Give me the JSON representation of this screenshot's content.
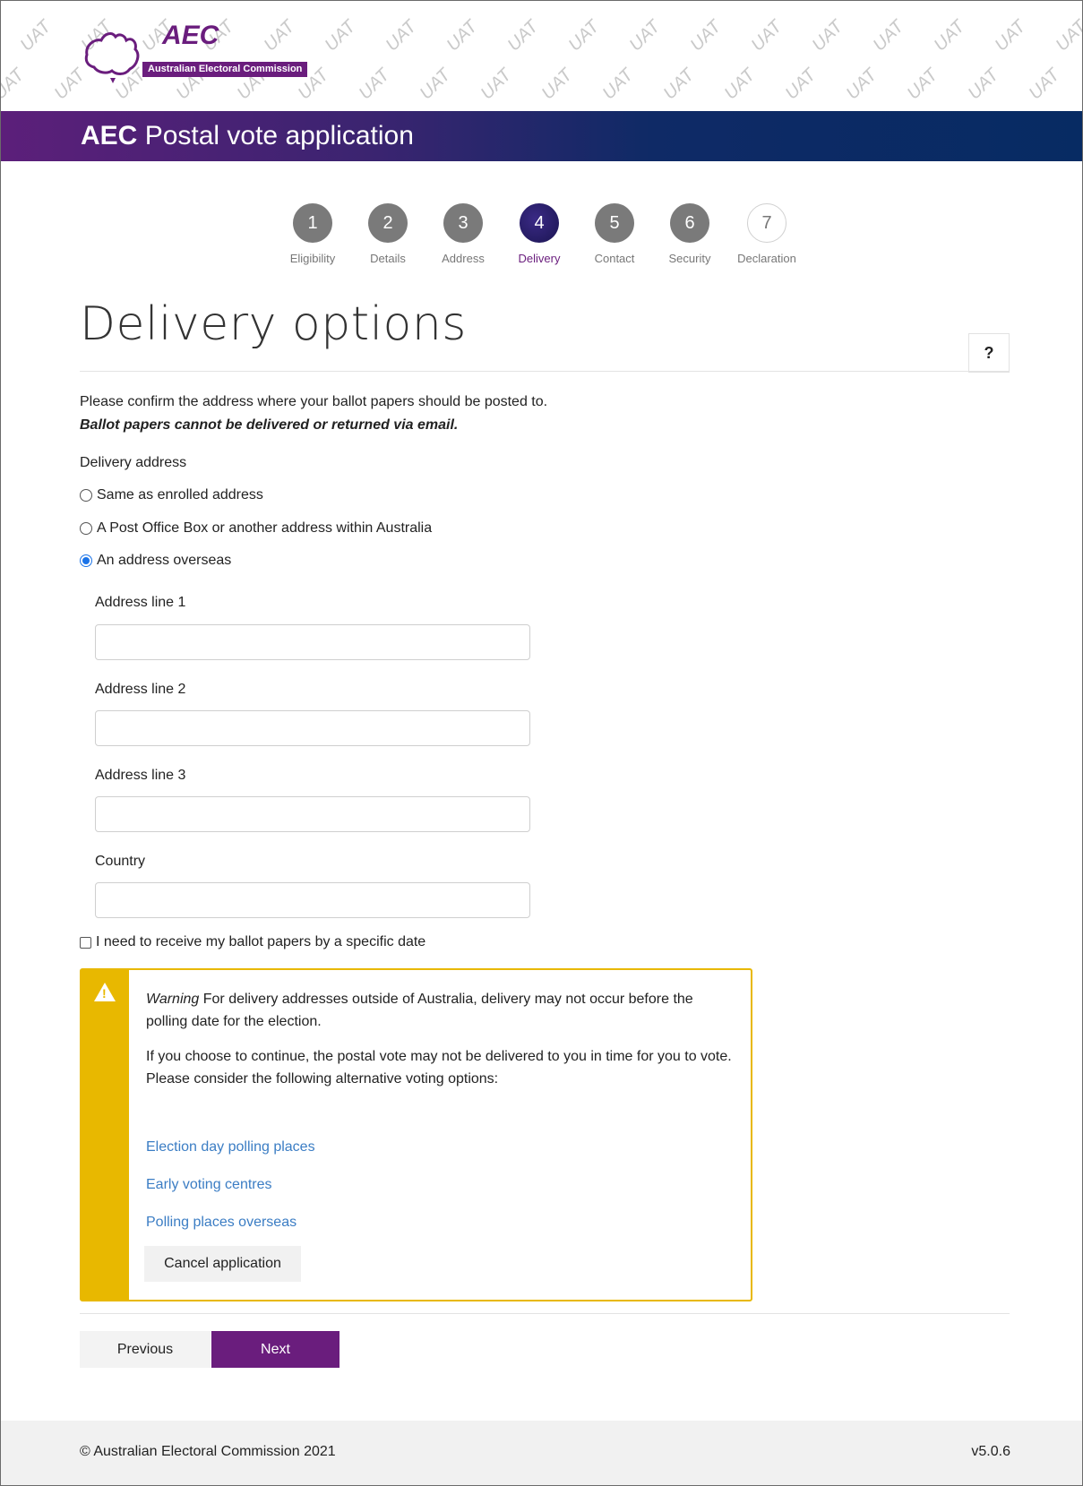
{
  "header": {
    "logo_abbr": "AEC",
    "logo_full": "Australian Electoral Commission",
    "watermark": "UAT",
    "app_title_bold": "AEC",
    "app_title_rest": "Postal vote application"
  },
  "steps": [
    {
      "number": "1",
      "label": "Eligibility",
      "state": "done"
    },
    {
      "number": "2",
      "label": "Details",
      "state": "done"
    },
    {
      "number": "3",
      "label": "Address",
      "state": "done"
    },
    {
      "number": "4",
      "label": "Delivery",
      "state": "active"
    },
    {
      "number": "5",
      "label": "Contact",
      "state": "done"
    },
    {
      "number": "6",
      "label": "Security",
      "state": "done"
    },
    {
      "number": "7",
      "label": "Declaration",
      "state": "pending"
    }
  ],
  "page": {
    "title": "Delivery options",
    "help_label": "?",
    "intro": "Please confirm the address where your ballot papers should be posted to.",
    "intro_emphasis": "Ballot papers cannot be delivered or returned via email.",
    "delivery_label": "Delivery address"
  },
  "delivery_options": [
    {
      "label": "Same as enrolled address",
      "checked": false
    },
    {
      "label": "A Post Office Box or another address within Australia",
      "checked": false
    },
    {
      "label": "An address overseas",
      "checked": true
    }
  ],
  "fields": {
    "address1": {
      "label": "Address line 1",
      "value": ""
    },
    "address2": {
      "label": "Address line 2",
      "value": ""
    },
    "address3": {
      "label": "Address line 3",
      "value": ""
    },
    "country": {
      "label": "Country",
      "value": ""
    }
  },
  "specific_date": {
    "label": "I need to receive my ballot papers by a specific date",
    "checked": false
  },
  "warning": {
    "title": "Warning",
    "text1": "For delivery addresses outside of Australia, delivery may not occur before the polling date for the election.",
    "text2": "If you choose to continue, the postal vote may not be delivered to you in time for you to vote.",
    "text3": "Please consider the following alternative voting options:",
    "links": [
      "Election day polling places",
      "Early voting centres",
      "Polling places overseas"
    ],
    "cancel_label": "Cancel application"
  },
  "nav": {
    "previous": "Previous",
    "next": "Next"
  },
  "footer": {
    "copyright": "© Australian Electoral Commission 2021",
    "version": "v5.0.6"
  },
  "colors": {
    "brand_purple": "#6a1d7d",
    "navy": "#072b63",
    "warning": "#e8b800",
    "link": "#3b7dc4"
  }
}
